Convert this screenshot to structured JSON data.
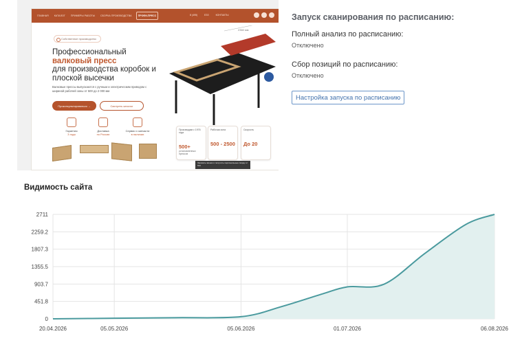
{
  "preview": {
    "nav_links": [
      "ГЛАВНАЯ",
      "КАТАЛОГ",
      "ПРИМЕРЫ РАБОТЫ",
      "СБОРКА ПРОИЗВОДСТВА"
    ],
    "logo": "ПРОФИ-ПРЕСС",
    "phones": [
      "8 (495)",
      "ЕЗЗ",
      "КОНТАКТЫ"
    ],
    "badge": "Собственное производство",
    "title_line1": "Профессиональный",
    "title_accent": "валковый пресс",
    "title_line3": "для производства коробок и плоской высечки",
    "description": "Валковые прессы выпускаются с ручным и электрическим приводом с шириной рабочей зоны от 500 до 2 000 мм",
    "btn_primary": "Проконсультироваться →",
    "btn_secondary": "Смотреть каталог",
    "features": [
      {
        "line1": "Гарантия",
        "line2": "3 года"
      },
      {
        "line1": "Доставка",
        "line2": "по России"
      },
      {
        "line1": "Сервис и запчасти",
        "line2": "в наличии"
      }
    ],
    "stats": [
      {
        "head": "Производим с 1976 года",
        "value": "500+",
        "sub": "установленных прессов"
      },
      {
        "head": "Рабочая зона",
        "value": "500 - 2500",
        "sub": ""
      },
      {
        "head": "Скорость",
        "value": "До 20",
        "sub": ""
      }
    ],
    "dimension_label": "2360 мм",
    "tooltip": "Заказать звонок и получить персональные скидку от 5%!"
  },
  "schedule": {
    "title": "Запуск сканирования по расписанию:",
    "full_analysis_label": "Полный анализ по расписанию:",
    "full_analysis_status": "Отключено",
    "positions_label": "Сбор позиций по расписанию:",
    "positions_status": "Отключено",
    "settings_button": "Настройка запуска по расписанию"
  },
  "colors": {
    "brand": "#b5532c",
    "chart_line": "#4a9a9e",
    "chart_fill": "#e2f0ef",
    "link_button": "#4473ad"
  },
  "chart_data": {
    "type": "area",
    "title": "Видимость сайта",
    "xlabel": "",
    "ylabel": "",
    "x_ticks": [
      "20.04.2026",
      "05.05.2026",
      "05.06.2026",
      "01.07.2026",
      "06.08.2026"
    ],
    "y_ticks": [
      0,
      451.8,
      903.7,
      1355.5,
      1807.3,
      2259.2,
      2711
    ],
    "ylim": [
      0,
      2711
    ],
    "grid": true,
    "series": [
      {
        "x": [
          "20.04.2026",
          "05.05.2026",
          "20.05.2026",
          "05.06.2026",
          "15.06.2026",
          "25.06.2026",
          "01.07.2026",
          "10.07.2026",
          "20.07.2026",
          "30.07.2026",
          "06.08.2026"
        ],
        "y": [
          0,
          15,
          30,
          55,
          320,
          650,
          830,
          900,
          1700,
          2450,
          2711
        ]
      }
    ]
  }
}
